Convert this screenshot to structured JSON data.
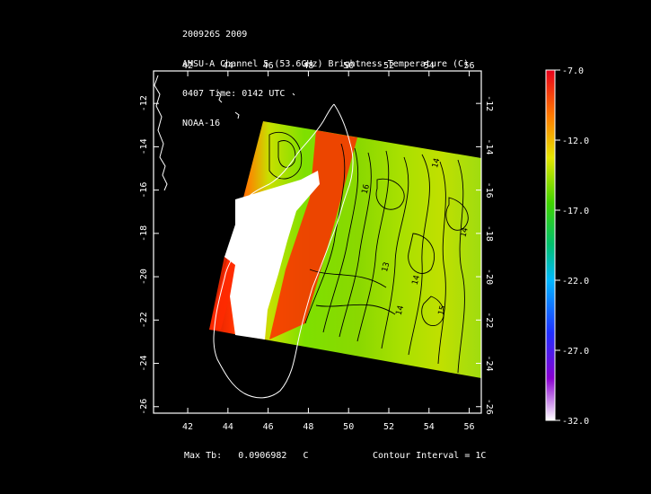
{
  "header": {
    "line1": "200926S 2009",
    "line2": "AMSU-A Channel 5 (53.6GHz) Brightness Temperature (C)",
    "line3": "0407 Time: 0142 UTC",
    "line4": "NOAA-16"
  },
  "map": {
    "lon_ticks": [
      "42",
      "44",
      "46",
      "48",
      "50",
      "52",
      "54",
      "56"
    ],
    "lat_ticks": [
      "-12",
      "-14",
      "-16",
      "-18",
      "-20",
      "-22",
      "-24",
      "-26"
    ],
    "lon_range": [
      40.3,
      56.6
    ],
    "lat_range": [
      -26.3,
      -10.5
    ],
    "contour_labels": [
      {
        "text": "16",
        "lon": 50.9,
        "lat": -16.2
      },
      {
        "text": "13",
        "lon": 51.9,
        "lat": -19.8
      },
      {
        "text": "14",
        "lon": 52.6,
        "lat": -21.8
      },
      {
        "text": "14",
        "lon": 53.4,
        "lat": -20.4
      },
      {
        "text": "14",
        "lon": 54.4,
        "lat": -15.0
      },
      {
        "text": "15",
        "lon": 54.7,
        "lat": -21.8
      },
      {
        "text": "14",
        "lon": 55.8,
        "lat": -18.2
      }
    ]
  },
  "colorbar": {
    "labels": [
      "-7.0",
      "-12.0",
      "-17.0",
      "-22.0",
      "-27.0",
      "-32.0"
    ],
    "max": -7.0,
    "min": -32.0
  },
  "footer": {
    "max_label": "Max Tb:",
    "max_value": "0.0906982",
    "max_unit": "C",
    "contour_interval": "Contour Interval = 1C"
  }
}
